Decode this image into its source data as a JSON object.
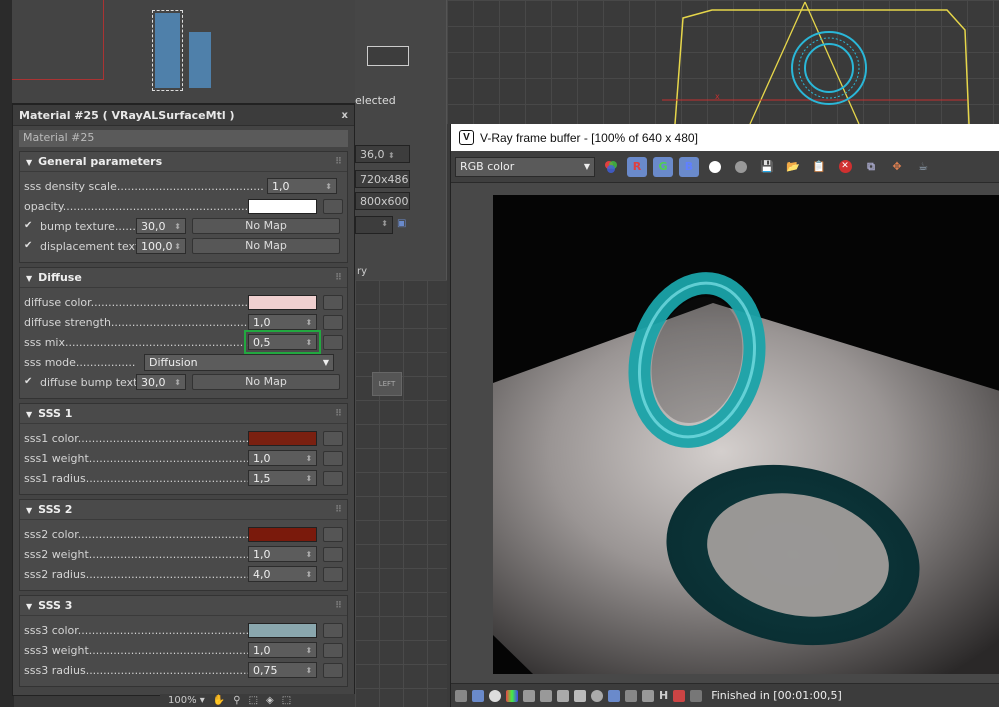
{
  "mid_panel": {
    "frag_selected": "elected",
    "fov": "36,0",
    "res1": "720x486",
    "res2": "800x600",
    "frag_ry": "ry"
  },
  "viewport": {
    "left_label": "LEFT",
    "x_axis": "x"
  },
  "material": {
    "title": "Material #25  ( VRayALSurfaceMtl )",
    "close": "x",
    "name": "Material #25",
    "general": {
      "heading": "General parameters",
      "sss_density_label": "sss density scale..........................................",
      "sss_density": "1,0",
      "opacity_label": "opacity........................................................................",
      "opacity_color": "#ffffff",
      "bump_label": "bump texture......",
      "bump_value": "30,0",
      "bump_map": "No Map",
      "disp_label": "displacement textu",
      "disp_value": "100,0",
      "disp_map": "No Map"
    },
    "diffuse": {
      "heading": "Diffuse",
      "color_label": "diffuse color..........................................................",
      "color": "#f0d0d0",
      "strength_label": "diffuse strength......................................................",
      "strength": "1,0",
      "mix_label": "sss mix...................................................................",
      "mix": "0,5",
      "mode_label": "sss mode.................",
      "mode": "Diffusion",
      "bump_label": "diffuse bump textu",
      "bump_value": "30,0",
      "bump_map": "No Map"
    },
    "sss1": {
      "heading": "SSS 1",
      "color_label": "sss1 color..............................................................",
      "color": "#7a2010",
      "weight_label": "sss1 weight............................................................",
      "weight": "1,0",
      "radius_label": "sss1 radius............................................................",
      "radius": "1,5"
    },
    "sss2": {
      "heading": "SSS 2",
      "color_label": "sss2 color..............................................................",
      "color": "#7a1a0c",
      "weight_label": "sss2 weight............................................................",
      "weight": "1,0",
      "radius_label": "sss2 radius............................................................",
      "radius": "4,0"
    },
    "sss3": {
      "heading": "SSS 3",
      "color_label": "sss3 color..............................................................",
      "color": "#8aa7ae",
      "weight_label": "sss3 weight............................................................",
      "weight": "1,0",
      "radius_label": "sss3 radius............................................................",
      "radius": "0,75"
    }
  },
  "bottom_bar": {
    "zoom": "100%"
  },
  "vfb": {
    "logo": "V",
    "title": "V-Ray frame buffer - [100% of 640 x 480]",
    "channel": "RGB color",
    "btn_r": "R",
    "btn_g": "G",
    "btn_b": "B",
    "status": "Finished in [00:01:00,5]",
    "status_h": "H"
  }
}
